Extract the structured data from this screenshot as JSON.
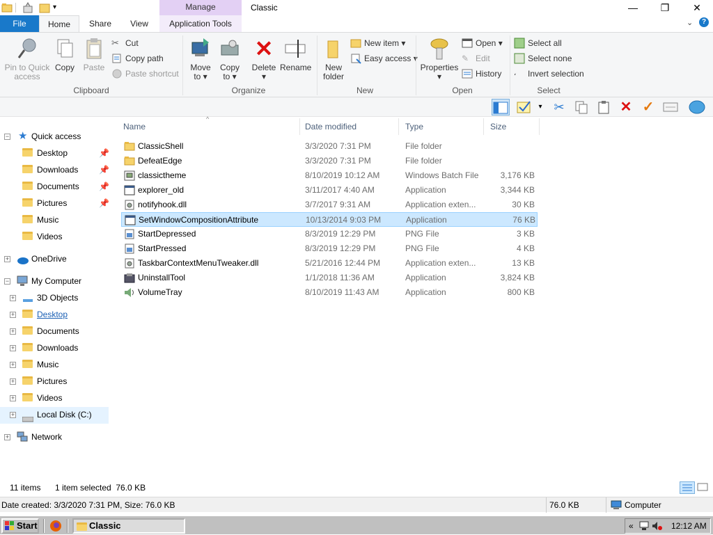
{
  "window": {
    "title": "Classic",
    "manage_label": "Manage",
    "controls": {
      "minimize": "—",
      "maximize": "❐",
      "close": "✕"
    }
  },
  "tabs": {
    "file": "File",
    "home": "Home",
    "share": "Share",
    "view": "View",
    "app_tools": "Application Tools"
  },
  "ribbon": {
    "clipboard": {
      "label": "Clipboard",
      "pin_l1": "Pin to Quick",
      "pin_l2": "access",
      "copy": "Copy",
      "paste": "Paste",
      "cut": "Cut",
      "copy_path": "Copy path",
      "paste_shortcut": "Paste shortcut"
    },
    "organize": {
      "label": "Organize",
      "move_l1": "Move",
      "move_l2": "to",
      "copy_l1": "Copy",
      "copy_l2": "to",
      "delete": "Delete",
      "rename": "Rename"
    },
    "new": {
      "label": "New",
      "folder_l1": "New",
      "folder_l2": "folder",
      "new_item": "New item",
      "easy_access": "Easy access"
    },
    "open": {
      "label": "Open",
      "properties": "Properties",
      "open": "Open",
      "edit": "Edit",
      "history": "History"
    },
    "select": {
      "label": "Select",
      "select_all": "Select all",
      "select_none": "Select none",
      "invert": "Invert selection"
    }
  },
  "nav": {
    "quick_access": "Quick access",
    "qa_items": [
      {
        "label": "Desktop"
      },
      {
        "label": "Downloads"
      },
      {
        "label": "Documents"
      },
      {
        "label": "Pictures"
      },
      {
        "label": "Music"
      },
      {
        "label": "Videos"
      }
    ],
    "onedrive": "OneDrive",
    "my_computer": "My Computer",
    "mc_items": [
      {
        "label": "3D Objects"
      },
      {
        "label": "Desktop"
      },
      {
        "label": "Documents"
      },
      {
        "label": "Downloads"
      },
      {
        "label": "Music"
      },
      {
        "label": "Pictures"
      },
      {
        "label": "Videos"
      },
      {
        "label": "Local Disk (C:)"
      }
    ],
    "network": "Network"
  },
  "columns": {
    "name": "Name",
    "date": "Date modified",
    "type": "Type",
    "size": "Size"
  },
  "files": [
    {
      "name": "ClassicShell",
      "date": "3/3/2020 7:31 PM",
      "type": "File folder",
      "size": "",
      "icon": "folder-icon"
    },
    {
      "name": "DefeatEdge",
      "date": "3/3/2020 7:31 PM",
      "type": "File folder",
      "size": "",
      "icon": "folder-icon"
    },
    {
      "name": "classictheme",
      "date": "8/10/2019 10:12 AM",
      "type": "Windows Batch File",
      "size": "3,176 KB",
      "icon": "batch-file-icon"
    },
    {
      "name": "explorer_old",
      "date": "3/11/2017 4:40 AM",
      "type": "Application",
      "size": "3,344 KB",
      "icon": "application-icon"
    },
    {
      "name": "notifyhook.dll",
      "date": "3/7/2017 9:31 AM",
      "type": "Application exten...",
      "size": "30 KB",
      "icon": "dll-icon"
    },
    {
      "name": "SetWindowCompositionAttribute",
      "date": "10/13/2014 9:03 PM",
      "type": "Application",
      "size": "76 KB",
      "icon": "application-icon"
    },
    {
      "name": "StartDepressed",
      "date": "8/3/2019 12:29 PM",
      "type": "PNG File",
      "size": "3 KB",
      "icon": "png-file-icon"
    },
    {
      "name": "StartPressed",
      "date": "8/3/2019 12:29 PM",
      "type": "PNG File",
      "size": "4 KB",
      "icon": "png-file-icon"
    },
    {
      "name": "TaskbarContextMenuTweaker.dll",
      "date": "5/21/2016 12:44 PM",
      "type": "Application exten...",
      "size": "13 KB",
      "icon": "dll-icon"
    },
    {
      "name": "UninstallTool",
      "date": "1/1/2018 11:36 AM",
      "type": "Application",
      "size": "3,824 KB",
      "icon": "uninstall-tool-icon"
    },
    {
      "name": "VolumeTray",
      "date": "8/10/2019 11:43 AM",
      "type": "Application",
      "size": "800 KB",
      "icon": "volume-tray-icon"
    }
  ],
  "selected_row": 5,
  "status": {
    "items": "11 items",
    "selected": "1 item selected  76.0 KB",
    "details": "Date created: 3/3/2020 7:31 PM, Size: 76.0 KB",
    "size": "76.0 KB",
    "location": "Computer"
  },
  "taskbar": {
    "start": "Start",
    "window_button": "Classic",
    "clock": "12:12 AM",
    "tray_arrows": "«"
  }
}
